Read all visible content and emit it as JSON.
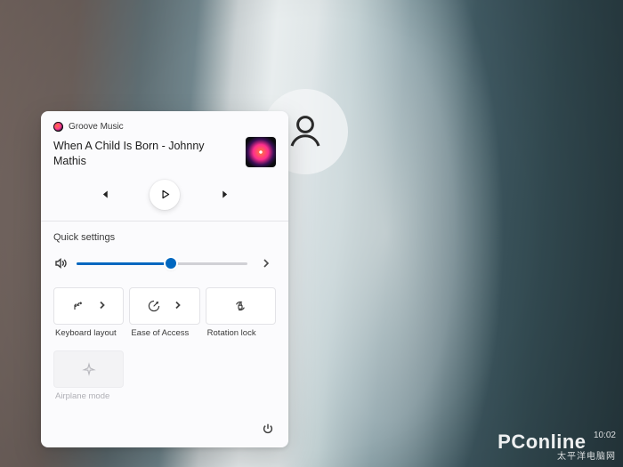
{
  "media": {
    "app_name": "Groove Music",
    "track": "When A Child Is Born - Johnny Mathis"
  },
  "quick_settings": {
    "title": "Quick settings",
    "volume_percent": 55,
    "tiles": [
      {
        "id": "keyboard-layout",
        "label": "Keyboard layout",
        "has_chevron": true,
        "disabled": false
      },
      {
        "id": "ease-of-access",
        "label": "Ease of Access",
        "has_chevron": true,
        "disabled": false
      },
      {
        "id": "rotation-lock",
        "label": "Rotation lock",
        "has_chevron": false,
        "disabled": false
      },
      {
        "id": "airplane-mode",
        "label": "Airplane mode",
        "has_chevron": false,
        "disabled": true
      }
    ]
  },
  "accent_color": "#0067c0",
  "watermark": {
    "brand": "PConline",
    "subtitle": "太平洋电脑网",
    "time": "10:02"
  }
}
